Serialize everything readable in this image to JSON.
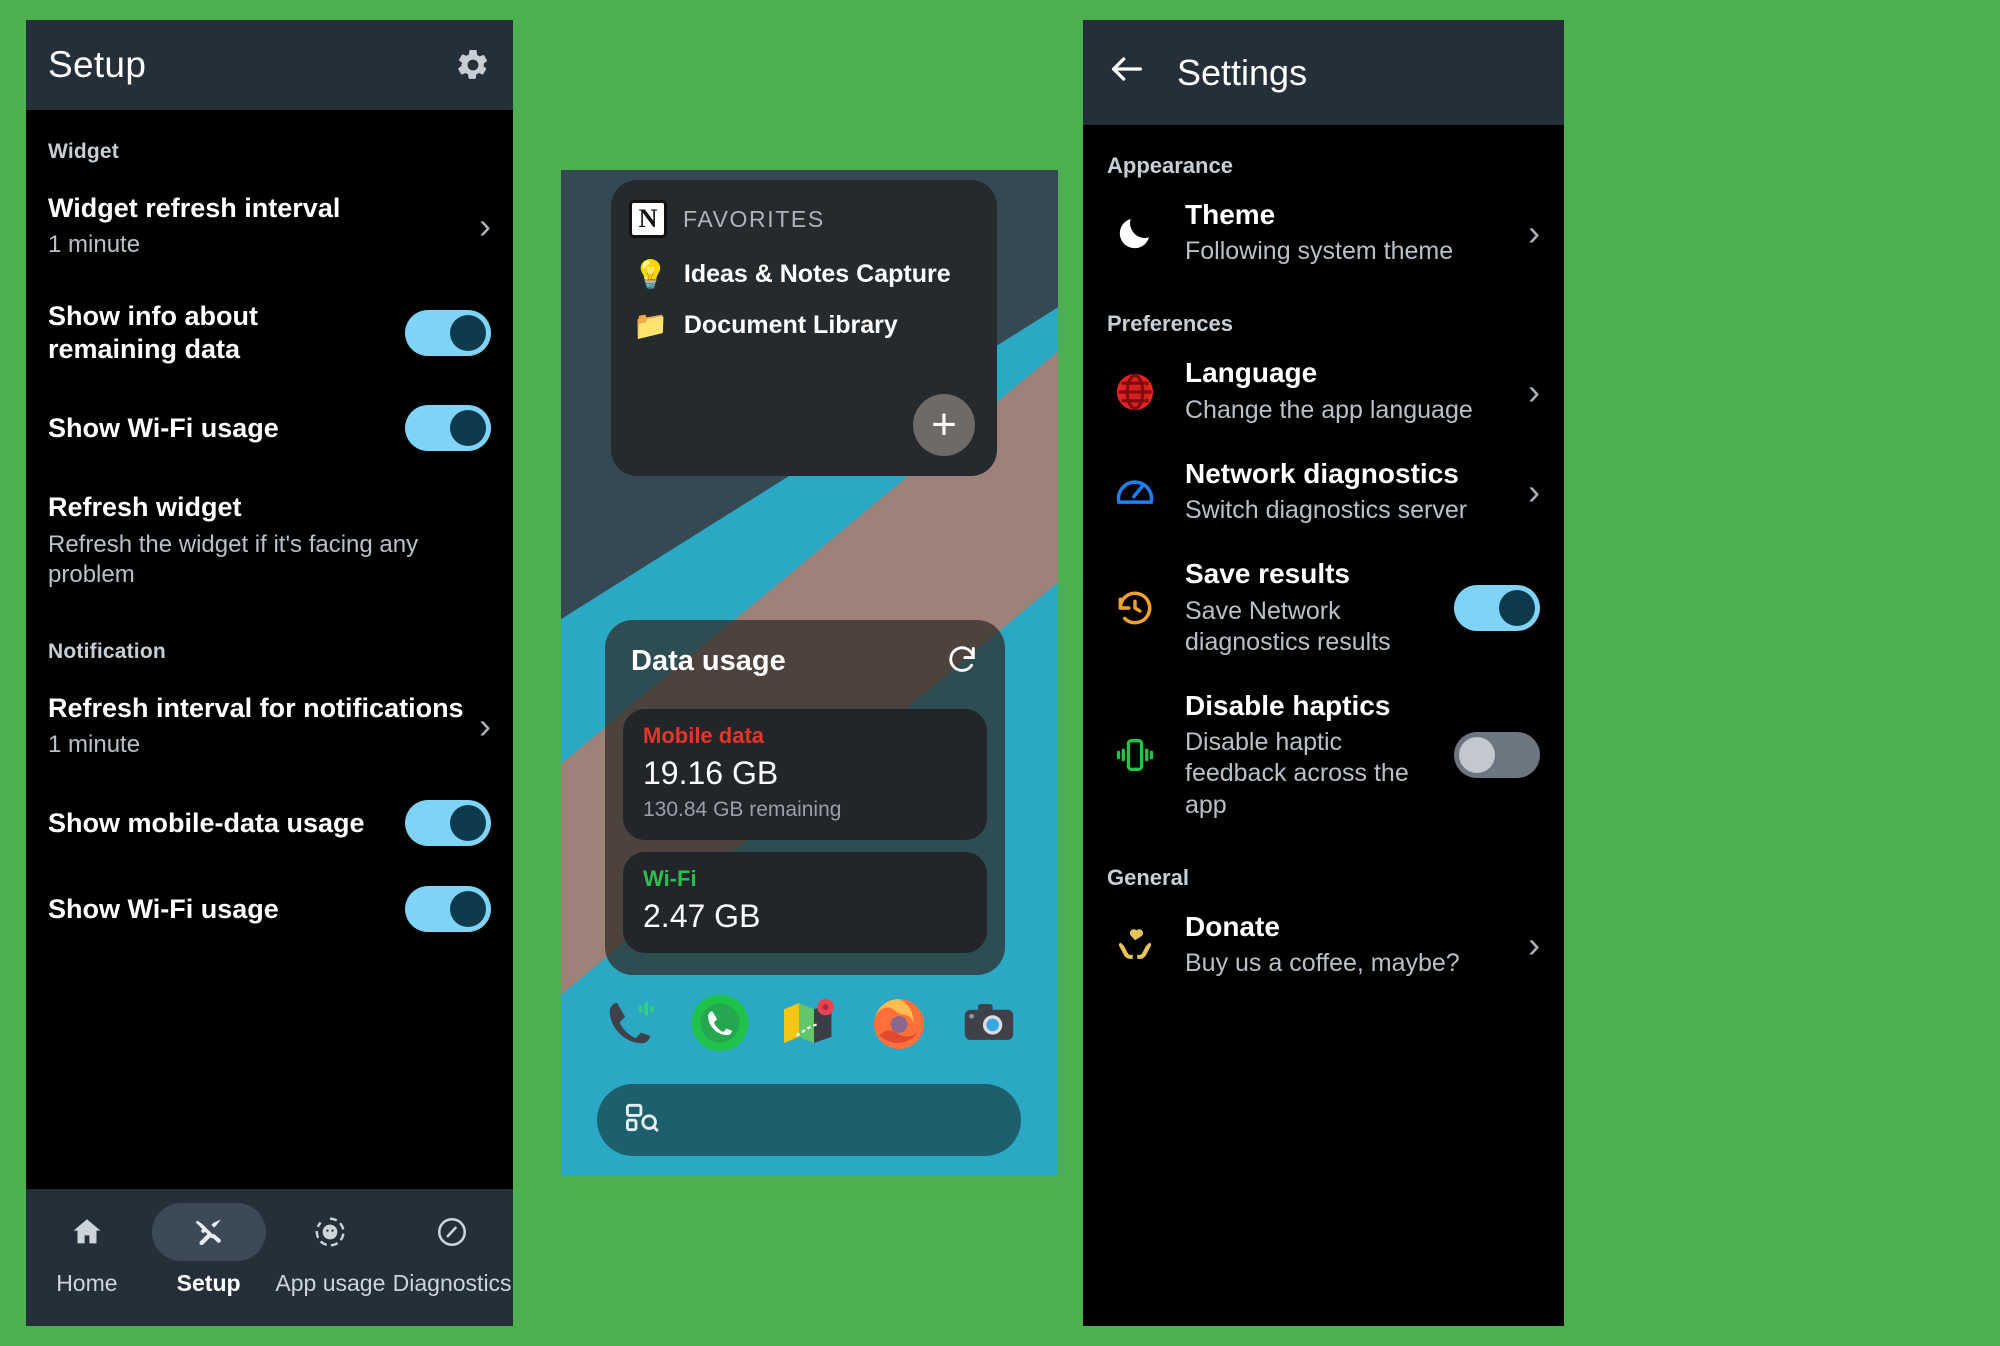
{
  "panel_setup": {
    "appbar": {
      "title": "Setup",
      "settings_icon": "gear-icon"
    },
    "sections": [
      {
        "heading": "Widget",
        "rows": [
          {
            "title": "Widget refresh interval",
            "subtitle": "1 minute",
            "control": "chevron",
            "chevron": "›"
          },
          {
            "title": "Show info about remaining data",
            "subtitle": "",
            "control": "toggle",
            "toggle": "on"
          },
          {
            "title": "Show Wi-Fi usage",
            "subtitle": "",
            "control": "toggle",
            "toggle": "on"
          },
          {
            "title": "Refresh widget",
            "subtitle": "Refresh the widget if it's facing any problem",
            "control": "none"
          }
        ]
      },
      {
        "heading": "Notification",
        "rows": [
          {
            "title": "Refresh interval for notifications",
            "subtitle": "1 minute",
            "control": "chevron",
            "chevron": "›"
          },
          {
            "title": "Show mobile-data usage",
            "subtitle": "",
            "control": "toggle",
            "toggle": "on"
          },
          {
            "title": "Show Wi-Fi usage",
            "subtitle": "",
            "control": "toggle",
            "toggle": "on"
          }
        ]
      }
    ],
    "bottom_nav": [
      {
        "label": "Home",
        "icon": "home-icon",
        "active": false
      },
      {
        "label": "Setup",
        "icon": "tools-icon",
        "active": true
      },
      {
        "label": "App usage",
        "icon": "android-usage-icon",
        "active": false
      },
      {
        "label": "Diagnostics",
        "icon": "speedometer-icon",
        "active": false
      }
    ]
  },
  "panel_home": {
    "notion_widget": {
      "logo": "N",
      "title": "FAVORITES",
      "items": [
        {
          "emoji": "💡",
          "label": "Ideas & Notes Capture"
        },
        {
          "emoji": "📁",
          "label": "Document Library"
        }
      ],
      "add_button": "+"
    },
    "data_widget": {
      "title": "Data usage",
      "refresh_icon": "refresh-icon",
      "cards": [
        {
          "label": "Mobile data",
          "value": "19.16 GB",
          "remaining": "130.84 GB remaining",
          "color": "#e8352c"
        },
        {
          "label": "Wi-Fi",
          "value": "2.47 GB",
          "remaining": "",
          "color": "#2bc04d"
        }
      ]
    },
    "dock": [
      {
        "icon": "call-recorder-icon",
        "glyph": "📞"
      },
      {
        "icon": "phone-icon",
        "glyph": "☎"
      },
      {
        "icon": "maps-icon",
        "glyph": "🗺"
      },
      {
        "icon": "firefox-icon",
        "glyph": "🦊"
      },
      {
        "icon": "camera-icon",
        "glyph": "📷"
      }
    ],
    "search_bar": {
      "icon": "search-widget-icon",
      "placeholder": ""
    }
  },
  "panel_settings": {
    "appbar": {
      "back_icon": "back-arrow-icon",
      "title": "Settings"
    },
    "sections": [
      {
        "heading": "Appearance",
        "rows": [
          {
            "icon": "moon-icon",
            "icon_color": "#ffffff",
            "title": "Theme",
            "subtitle": "Following system theme",
            "control": "chevron",
            "chevron": "›"
          }
        ]
      },
      {
        "heading": "Preferences",
        "rows": [
          {
            "icon": "globe-icon",
            "icon_color": "#ee2222",
            "title": "Language",
            "subtitle": "Change the app language",
            "control": "chevron",
            "chevron": "›"
          },
          {
            "icon": "speedometer-icon",
            "icon_color": "#1f7ff5",
            "title": "Network diagnostics",
            "subtitle": "Switch diagnostics server",
            "control": "chevron",
            "chevron": "›"
          },
          {
            "icon": "history-icon",
            "icon_color": "#f0a12e",
            "title": "Save results",
            "subtitle": "Save Network diagnostics results",
            "control": "toggle",
            "toggle": "on"
          },
          {
            "icon": "vibration-icon",
            "icon_color": "#24c449",
            "title": "Disable haptics",
            "subtitle": "Disable haptic feedback across the app",
            "control": "toggle",
            "toggle": "off"
          }
        ]
      },
      {
        "heading": "General",
        "rows": [
          {
            "icon": "donate-heart-hands-icon",
            "icon_color": "#e8c25a",
            "title": "Donate",
            "subtitle": "Buy us a coffee, maybe?",
            "control": "chevron",
            "chevron": "›"
          }
        ]
      }
    ]
  },
  "colors": {
    "background_green": "#4caf50",
    "appbar": "#252f3a",
    "toggle_on": "#7fd3f7",
    "toggle_off": "#6c7680"
  }
}
